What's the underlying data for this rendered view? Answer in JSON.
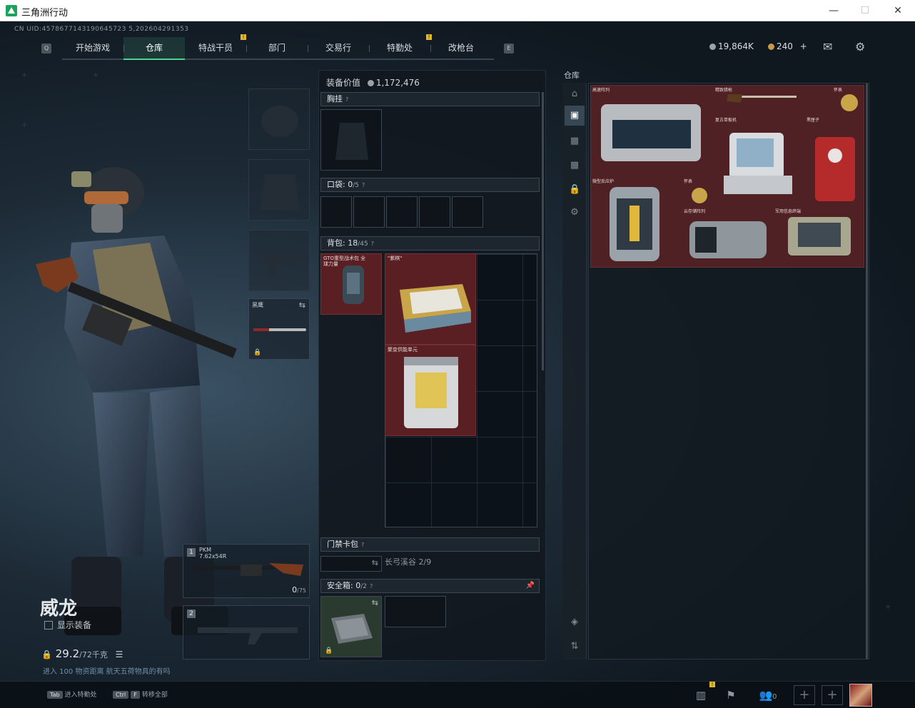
{
  "window": {
    "title": "三角洲行动",
    "min_glyph": "—",
    "max_glyph": "☐",
    "close_glyph": "✕"
  },
  "uid": "CN UID:4578677143190645723 5,202604291353",
  "nav": {
    "left_key": "Q",
    "right_key": "E",
    "tabs": [
      "开始游戏",
      "仓库",
      "特战干员",
      "部门",
      "交易行",
      "特勤处",
      "改枪台"
    ],
    "active_tab": "仓库",
    "badge": "!"
  },
  "currency": {
    "silver": "19,864K",
    "gold": "240",
    "gold_plus": "+",
    "silver_color": "#9aa3ab",
    "gold_color": "#c79a4a"
  },
  "icons": {
    "mail": "mail-icon",
    "settings": "gear-icon"
  },
  "character": {
    "name": "威龙",
    "show_equipment": "显示装备",
    "weight_value": "29.2",
    "weight_cap": "/72千克",
    "warning": "进入 100 物资距离 航天五荷物具的有吗"
  },
  "gear_slots": {
    "melee_label": "黑鹰",
    "primary": {
      "index": "1",
      "name": "PKM",
      "caliber": "7.62x54R",
      "ammo": "0",
      "ammo_cap": "/75"
    },
    "secondary": {
      "index": "2"
    }
  },
  "center": {
    "equip_value_label": "装备价值",
    "equip_value": "1,172,476",
    "chest_rig": "胸挂",
    "pockets": "口袋:",
    "pockets_count": "0",
    "pockets_cap": "/5",
    "backpack": "背包:",
    "backpack_count": "18",
    "backpack_cap": "/45",
    "backpack_item_label": "GTO重型战术包 全球力量",
    "item_chess_label": "\"紫棋\"",
    "item_reactor_label": "聚变供能单元",
    "keycard": "门禁卡包",
    "keycard_info": "长弓溪谷 2/9",
    "safe": "安全箱:",
    "safe_count": "0",
    "safe_cap": "/2"
  },
  "stash": {
    "title": "仓库",
    "items": [
      {
        "label": "高速阵列"
      },
      {
        "label": "精致猎枪"
      },
      {
        "label": "怀表"
      },
      {
        "label": "复古单板机"
      },
      {
        "label": "黑匣子"
      },
      {
        "label": "微型反应炉"
      },
      {
        "label": "怀表"
      },
      {
        "label": "云存储阵列"
      },
      {
        "label": "军用信息终端"
      }
    ]
  },
  "bottom": {
    "hint1_key": "Tab",
    "hint1": "进入特勤处",
    "hint2_key1": "Ctrl",
    "hint2_key2": "F",
    "hint2": "转移全部",
    "squad_count": "0",
    "plus": "+"
  }
}
